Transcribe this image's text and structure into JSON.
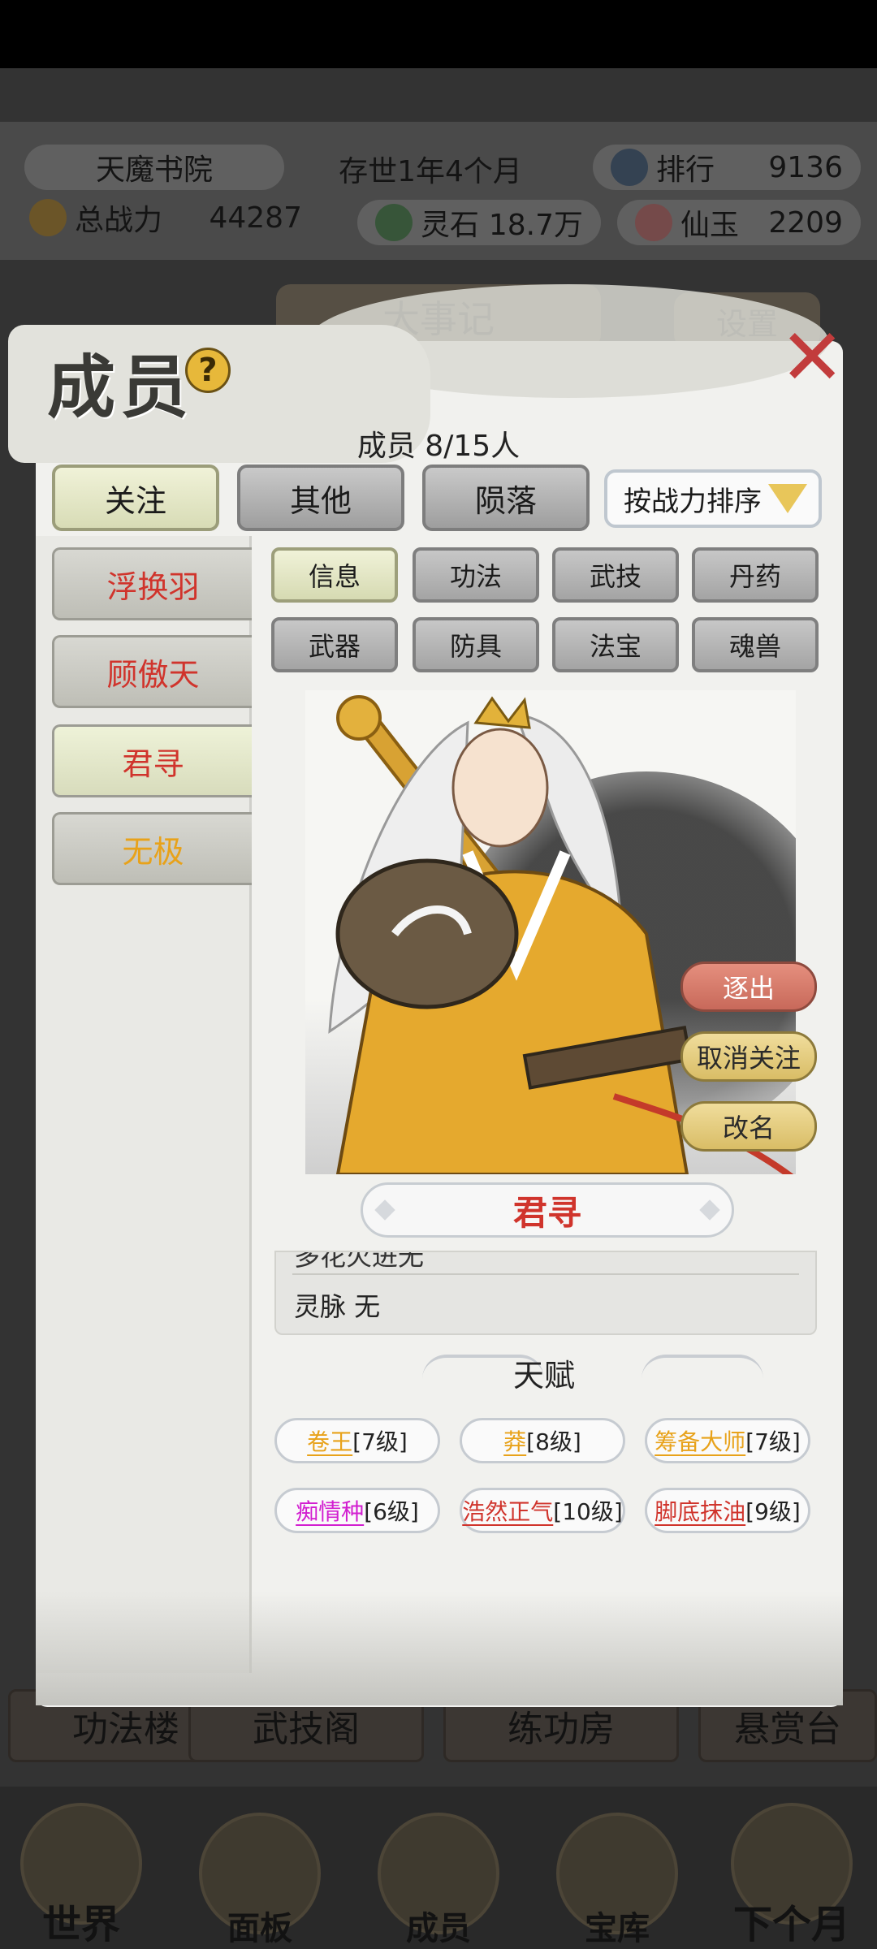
{
  "hud": {
    "sect_name": "天魔书院",
    "age": "存世1年4个月",
    "rank_label": "排行",
    "rank_value": "9136",
    "power_label": "总战力",
    "power_value": "44287",
    "stone_label": "灵石",
    "stone_value": "18.7万",
    "jade_label": "仙玉",
    "jade_value": "2209"
  },
  "bg": {
    "events_label": "大事记",
    "settings_label": "设置",
    "buildings": [
      "功法楼",
      "武技阁",
      "练功房",
      "悬赏台"
    ],
    "nav": [
      "世界",
      "面板",
      "成员",
      "宝库",
      "下个月"
    ]
  },
  "panel": {
    "title": "成员",
    "help_glyph": "?",
    "close_glyph": "✕",
    "count_text": "成员 8/15人",
    "filter_tabs": [
      "关注",
      "其他",
      "陨落"
    ],
    "sort_label": "按战力排序"
  },
  "members": [
    {
      "name": "浮换羽",
      "color": "#d0342c"
    },
    {
      "name": "顾傲天",
      "color": "#d0342c"
    },
    {
      "name": "君寻",
      "color": "#d0342c"
    },
    {
      "name": "无极",
      "color": "#e8a21a"
    }
  ],
  "detail_tabs": [
    "信息",
    "功法",
    "武技",
    "丹药",
    "武器",
    "防具",
    "法宝",
    "魂兽"
  ],
  "actions": {
    "expel": "逐出",
    "unfollow": "取消关注",
    "rename": "改名"
  },
  "selected_name": "君寻",
  "info": {
    "cut_line": "多花火进无",
    "spirit_vein": "灵脉 无"
  },
  "talent_header": "天赋",
  "talents": [
    {
      "name": "卷王",
      "level": "[7级]",
      "color": "#e8a21a"
    },
    {
      "name": "莽",
      "level": "[8级]",
      "color": "#e8a21a"
    },
    {
      "name": "筹备大师",
      "level": "[7级]",
      "color": "#e8a21a"
    },
    {
      "name": "痴情种",
      "level": "[6级]",
      "color": "#d21fd0"
    },
    {
      "name": "浩然正气",
      "level": "[10级]",
      "color": "#d0342c"
    },
    {
      "name": "脚底抹油",
      "level": "[9级]",
      "color": "#d0342c"
    }
  ]
}
